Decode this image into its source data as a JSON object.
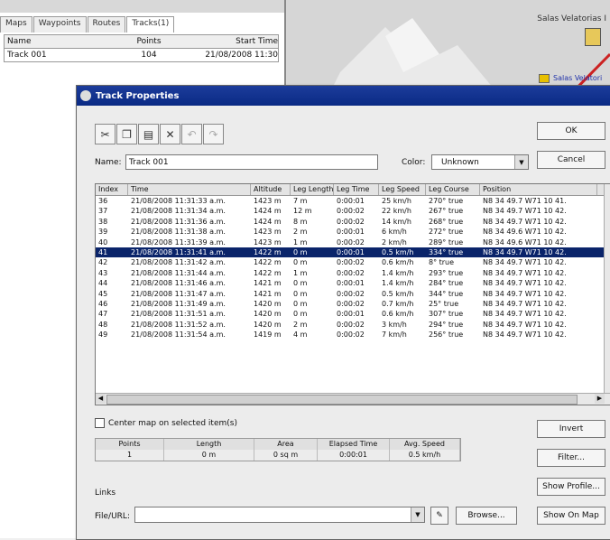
{
  "left_panel": {
    "tabs": [
      "Maps",
      "Waypoints",
      "Routes",
      "Tracks(1)"
    ],
    "columns": [
      "Name",
      "Points",
      "Start Time"
    ],
    "row": {
      "name": "Track 001",
      "points": "104",
      "start_time": "21/08/2008 11:30"
    }
  },
  "map": {
    "title": "Salas Velatorias I",
    "mark_label": "Salas Velatori"
  },
  "dialog": {
    "title": "Track Properties",
    "toolbar_icons": [
      "scissors-icon",
      "copy-icon",
      "paste-icon",
      "delete-icon",
      "undo-icon",
      "redo-icon"
    ],
    "name_label": "Name:",
    "name_value": "Track 001",
    "color_label": "Color:",
    "color_value": "Unknown",
    "ok_label": "OK",
    "cancel_label": "Cancel",
    "table": {
      "columns": [
        "Index",
        "Time",
        "Altitude",
        "Leg Length",
        "Leg Time",
        "Leg Speed",
        "Leg Course",
        "Position"
      ],
      "rows": [
        [
          "36",
          "21/08/2008 11:31:33 a.m.",
          "1423 m",
          "7 m",
          "0:00:01",
          "25 km/h",
          "270° true",
          "N8 34 49.7 W71 10 41."
        ],
        [
          "37",
          "21/08/2008 11:31:34 a.m.",
          "1424 m",
          "12 m",
          "0:00:02",
          "22 km/h",
          "267° true",
          "N8 34 49.7 W71 10 42."
        ],
        [
          "38",
          "21/08/2008 11:31:36 a.m.",
          "1424 m",
          "8 m",
          "0:00:02",
          "14 km/h",
          "268° true",
          "N8 34 49.7 W71 10 42."
        ],
        [
          "39",
          "21/08/2008 11:31:38 a.m.",
          "1423 m",
          "2 m",
          "0:00:01",
          "6 km/h",
          "272° true",
          "N8 34 49.6 W71 10 42."
        ],
        [
          "40",
          "21/08/2008 11:31:39 a.m.",
          "1423 m",
          "1 m",
          "0:00:02",
          "2 km/h",
          "289° true",
          "N8 34 49.6 W71 10 42."
        ],
        [
          "41",
          "21/08/2008 11:31:41 a.m.",
          "1422 m",
          "0 m",
          "0:00:01",
          "0.5 km/h",
          "334° true",
          "N8 34 49.7 W71 10 42."
        ],
        [
          "42",
          "21/08/2008 11:31:42 a.m.",
          "1422 m",
          "0 m",
          "0:00:02",
          "0.6 km/h",
          "8° true",
          "N8 34 49.7 W71 10 42."
        ],
        [
          "43",
          "21/08/2008 11:31:44 a.m.",
          "1422 m",
          "1 m",
          "0:00:02",
          "1.4 km/h",
          "293° true",
          "N8 34 49.7 W71 10 42."
        ],
        [
          "44",
          "21/08/2008 11:31:46 a.m.",
          "1421 m",
          "0 m",
          "0:00:01",
          "1.4 km/h",
          "284° true",
          "N8 34 49.7 W71 10 42."
        ],
        [
          "45",
          "21/08/2008 11:31:47 a.m.",
          "1421 m",
          "0 m",
          "0:00:02",
          "0.5 km/h",
          "344° true",
          "N8 34 49.7 W71 10 42."
        ],
        [
          "46",
          "21/08/2008 11:31:49 a.m.",
          "1420 m",
          "0 m",
          "0:00:02",
          "0.7 km/h",
          "25° true",
          "N8 34 49.7 W71 10 42."
        ],
        [
          "47",
          "21/08/2008 11:31:51 a.m.",
          "1420 m",
          "0 m",
          "0:00:01",
          "0.6 km/h",
          "307° true",
          "N8 34 49.7 W71 10 42."
        ],
        [
          "48",
          "21/08/2008 11:31:52 a.m.",
          "1420 m",
          "2 m",
          "0:00:02",
          "3 km/h",
          "294° true",
          "N8 34 49.7 W71 10 42."
        ],
        [
          "49",
          "21/08/2008 11:31:54 a.m.",
          "1419 m",
          "4 m",
          "0:00:02",
          "7 km/h",
          "256° true",
          "N8 34 49.7 W71 10 42."
        ]
      ],
      "selected_index": "41"
    },
    "center_map_label": "Center map on selected item(s)",
    "stats": {
      "headers": [
        "Points",
        "Length",
        "Area",
        "Elapsed Time",
        "Avg. Speed"
      ],
      "values": [
        "1",
        "0 m",
        "0 sq m",
        "0:00:01",
        "0.5 km/h"
      ]
    },
    "invert_label": "Invert",
    "filter_label": "Filter...",
    "show_profile_label": "Show Profile...",
    "show_on_map_label": "Show On Map",
    "links_label": "Links",
    "file_url_label": "File/URL:",
    "browse_label": "Browse..."
  }
}
